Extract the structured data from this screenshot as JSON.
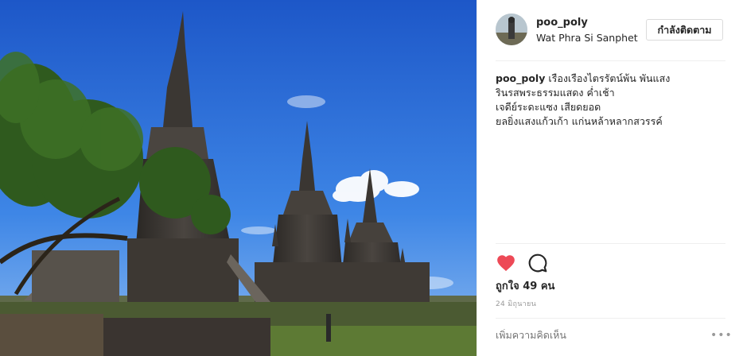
{
  "post": {
    "username": "poo_poly",
    "location": "Wat Phra Si Sanphet",
    "follow_label": "กำลังติดตาม",
    "caption_username": "poo_poly",
    "caption_lines": [
      "เรืองเรืองไตรรัตน์พ้น พันแสง",
      "รินรสพระธรรมแสดง ค่ำเช้า",
      "เจดีย์ระดะแซง เสียดยอด",
      "ยลยิ่งแสงแก้วเก้า แก่นหล้าหลากสวรรค์"
    ],
    "likes": "ถูกใจ 49 คน",
    "date": "24 มิถุนายน",
    "comment_placeholder": "เพิ่มความคิดเห็น",
    "more_label": "•••"
  },
  "icons": {
    "like": "heart-icon",
    "comment": "comment-icon",
    "more": "more-options-icon"
  },
  "colors": {
    "like_red": "#ed4956",
    "sky": "#2d6fd8",
    "text": "#262626",
    "muted": "#999999"
  }
}
